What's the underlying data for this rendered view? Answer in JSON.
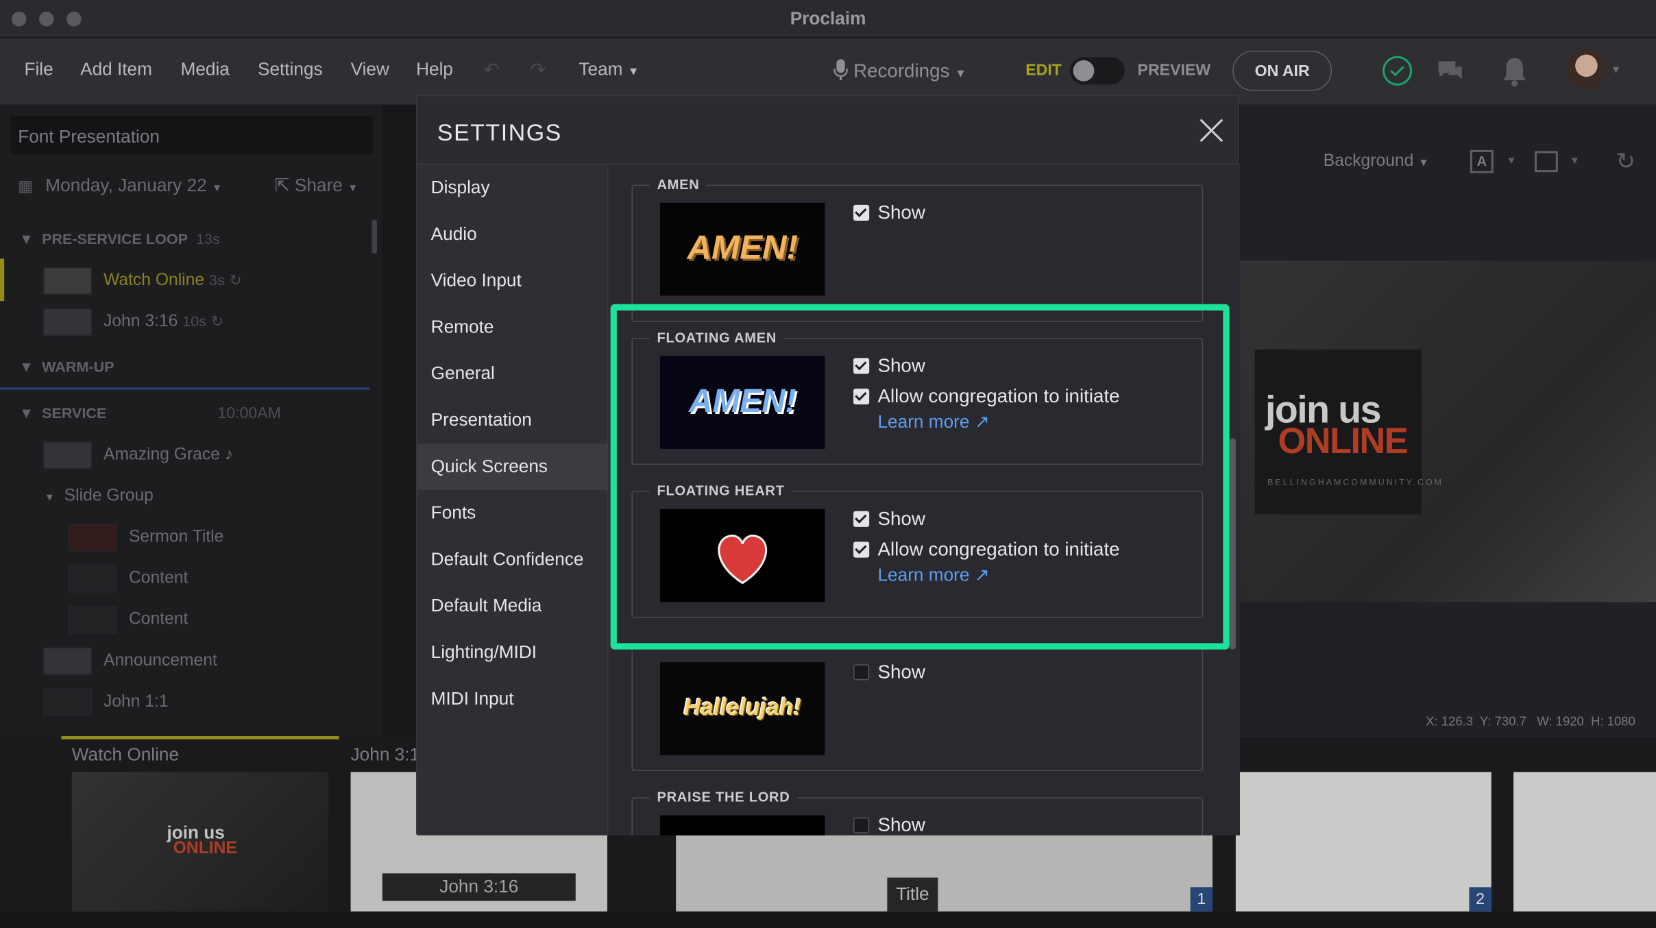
{
  "app": {
    "title": "Proclaim"
  },
  "menu": {
    "items": [
      "File",
      "Add Item",
      "Media",
      "Settings",
      "View",
      "Help"
    ],
    "team": "Team",
    "recordings": "Recordings",
    "edit": "EDIT",
    "preview": "PREVIEW",
    "on_air": "ON AIR"
  },
  "left": {
    "presentation": "Font Presentation",
    "date": "Monday, January 22",
    "share": "Share",
    "sections": [
      {
        "name": "PRE-SERVICE LOOP",
        "meta": "13s"
      },
      {
        "name": "WARM-UP",
        "meta": ""
      },
      {
        "name": "SERVICE",
        "meta": "10:00AM"
      }
    ],
    "items": {
      "watch_online": "Watch Online",
      "watch_online_time": "3s",
      "john316": "John 3:16",
      "john316_time": "10s",
      "amazing_grace": "Amazing Grace ♪",
      "slide_group": "Slide Group",
      "sermon_title": "Sermon Title",
      "content1": "Content",
      "content2": "Content",
      "announcement": "Announcement",
      "john11": "John 1:1"
    }
  },
  "toolbar": {
    "background": "Background"
  },
  "preview_panel": {
    "join": "join us",
    "online": "ONLINE",
    "url": "BELLINGHAMCOMMUNITY.COM",
    "coords": "X: 126.3  Y: 730.7   W: 1920  H: 1080"
  },
  "bottom": {
    "watch_online": "Watch Online",
    "john316": "John 3:1",
    "john316_caption": "John 3:16",
    "title_badge": "Title",
    "badge1": "1",
    "badge2": "2"
  },
  "settings": {
    "title": "SETTINGS",
    "nav": [
      "Display",
      "Audio",
      "Video Input",
      "Remote",
      "General",
      "Presentation",
      "Quick Screens",
      "Fonts",
      "Default Confidence",
      "Default Media",
      "Lighting/MIDI",
      "MIDI Input"
    ],
    "active_nav": "Quick Screens",
    "groups": {
      "amen": {
        "title": "AMEN",
        "preview": "AMEN!",
        "show": "Show"
      },
      "floating_amen": {
        "title": "FLOATING AMEN",
        "preview": "AMEN!",
        "show": "Show",
        "allow": "Allow congregation to initiate",
        "learn": "Learn more"
      },
      "floating_heart": {
        "title": "FLOATING HEART",
        "show": "Show",
        "allow": "Allow congregation to initiate",
        "learn": "Learn more"
      },
      "hallelujah": {
        "preview": "Hallelujah!",
        "show": "Show"
      },
      "praise": {
        "title": "PRAISE THE LORD",
        "show": "Show"
      }
    }
  },
  "colors": {
    "highlight": "#1de29a",
    "link": "#5b9ff0",
    "edit_accent": "#a8a220"
  }
}
